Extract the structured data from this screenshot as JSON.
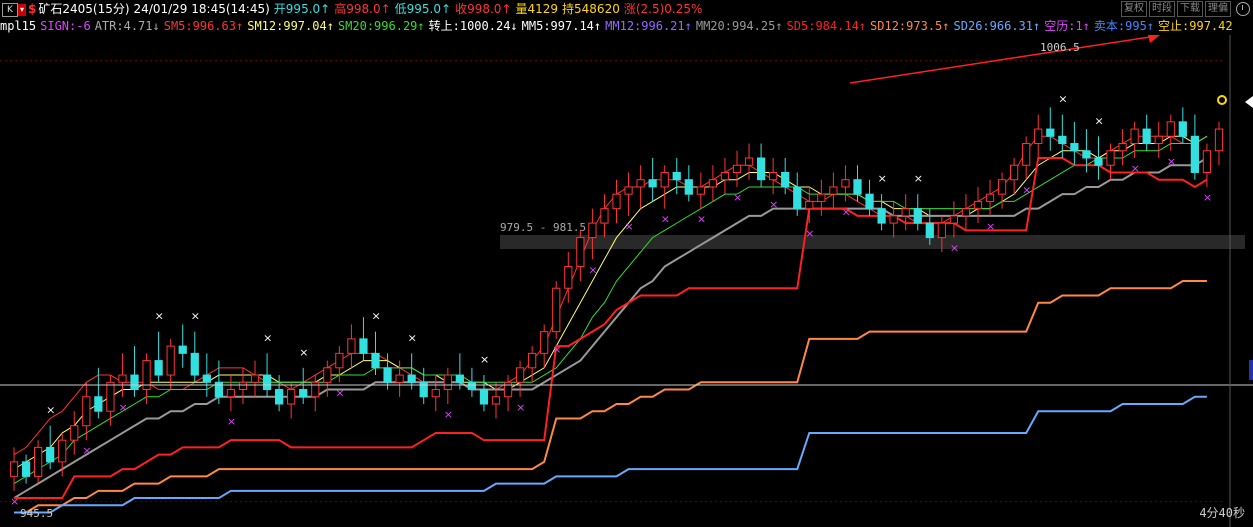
{
  "header": {
    "icon_k": "K",
    "symbol": "矿石2405(15分)",
    "datetime": "24/01/29 18:45(14:45)",
    "open": "开995.0↑",
    "high": "高998.0↑",
    "low": "低995.0↑",
    "close": "收998.0↑",
    "volume": "量4129",
    "hold": "持548620",
    "change": "涨(2.5)0.25%",
    "buttons": [
      "复权",
      "时段",
      "下载",
      "理偏"
    ]
  },
  "indicator": {
    "name": "mpl15",
    "sign": "SIGN:-6",
    "atr": "ATR:4.71↓",
    "sm5": "SM5:996.63↑",
    "sm12": "SM12:997.04↑",
    "sm20": "SM20:996.29↑",
    "turn": "转上:1000.24↓",
    "mm5": "MM5:997.14↑",
    "mm12": "MM12:996.21↑",
    "mm20": "MM20:994.25↑",
    "sd5": "SD5:984.14↑",
    "sd12": "SD12:973.5↑",
    "sd26": "SD26:966.31↑",
    "kongli": "空历:1↑",
    "maiben": "卖本:995↑",
    "kongzhi": "空止:997.42"
  },
  "colors": {
    "up": "#ff3333",
    "down": "#33e0e0",
    "yellow": "#ffd700",
    "sm5": "#ff3333",
    "sm12": "#ffff66",
    "sm20": "#33dd33",
    "mm5": "#ffffff",
    "mm12": "#9966ff",
    "mm20": "#999999",
    "sd5": "#ff2020",
    "sd12": "#ff8844",
    "sd26": "#66aaff",
    "kongli": "#dd44ff",
    "maiben": "#4488ff"
  },
  "annotations": {
    "high_label": "1006.5",
    "low_label": "945.5",
    "range_label": "979.5 - 981.5",
    "countdown": "4分40秒"
  },
  "chart_data": {
    "type": "candlestick",
    "ylim": [
      942,
      1010
    ],
    "ohlc": [
      [
        949,
        953,
        947,
        951
      ],
      [
        951,
        952,
        948,
        949
      ],
      [
        949,
        954,
        948,
        953
      ],
      [
        953,
        956,
        950,
        951
      ],
      [
        951,
        955,
        949,
        954
      ],
      [
        954,
        958,
        952,
        956
      ],
      [
        956,
        962,
        954,
        960
      ],
      [
        960,
        964,
        957,
        958
      ],
      [
        958,
        963,
        956,
        962
      ],
      [
        962,
        966,
        960,
        963
      ],
      [
        963,
        967,
        960,
        961
      ],
      [
        961,
        966,
        959,
        965
      ],
      [
        965,
        969,
        962,
        963
      ],
      [
        963,
        968,
        961,
        967
      ],
      [
        967,
        970,
        964,
        966
      ],
      [
        966,
        969,
        962,
        963
      ],
      [
        963,
        966,
        960,
        962
      ],
      [
        962,
        965,
        959,
        960
      ],
      [
        960,
        963,
        958,
        961
      ],
      [
        961,
        964,
        959,
        962
      ],
      [
        962,
        965,
        960,
        963
      ],
      [
        963,
        966,
        960,
        961
      ],
      [
        961,
        963,
        958,
        959
      ],
      [
        959,
        962,
        957,
        961
      ],
      [
        961,
        964,
        959,
        960
      ],
      [
        960,
        963,
        958,
        962
      ],
      [
        962,
        965,
        960,
        964
      ],
      [
        964,
        967,
        962,
        966
      ],
      [
        966,
        970,
        964,
        968
      ],
      [
        968,
        971,
        965,
        966
      ],
      [
        966,
        969,
        963,
        964
      ],
      [
        964,
        966,
        961,
        962
      ],
      [
        962,
        965,
        960,
        963
      ],
      [
        963,
        966,
        961,
        962
      ],
      [
        962,
        964,
        959,
        960
      ],
      [
        960,
        963,
        958,
        961
      ],
      [
        961,
        964,
        959,
        963
      ],
      [
        963,
        966,
        961,
        962
      ],
      [
        962,
        964,
        960,
        961
      ],
      [
        961,
        963,
        958,
        959
      ],
      [
        959,
        962,
        957,
        960
      ],
      [
        960,
        963,
        958,
        962
      ],
      [
        962,
        965,
        960,
        964
      ],
      [
        964,
        967,
        962,
        966
      ],
      [
        966,
        970,
        964,
        969
      ],
      [
        969,
        976,
        968,
        975
      ],
      [
        975,
        980,
        973,
        978
      ],
      [
        978,
        983,
        976,
        982
      ],
      [
        982,
        986,
        979,
        984
      ],
      [
        984,
        988,
        982,
        986
      ],
      [
        986,
        990,
        984,
        988
      ],
      [
        988,
        991,
        985,
        989
      ],
      [
        989,
        992,
        986,
        990
      ],
      [
        990,
        993,
        987,
        989
      ],
      [
        989,
        992,
        986,
        991
      ],
      [
        991,
        993,
        988,
        990
      ],
      [
        990,
        992,
        987,
        988
      ],
      [
        988,
        991,
        986,
        989
      ],
      [
        989,
        992,
        987,
        990
      ],
      [
        990,
        993,
        988,
        991
      ],
      [
        991,
        994,
        989,
        992
      ],
      [
        992,
        995,
        990,
        993
      ],
      [
        993,
        995,
        989,
        990
      ],
      [
        990,
        993,
        988,
        991
      ],
      [
        991,
        993,
        988,
        989
      ],
      [
        989,
        991,
        985,
        986
      ],
      [
        986,
        989,
        984,
        987
      ],
      [
        987,
        990,
        985,
        988
      ],
      [
        988,
        991,
        986,
        989
      ],
      [
        989,
        992,
        987,
        990
      ],
      [
        990,
        992,
        987,
        988
      ],
      [
        988,
        990,
        985,
        986
      ],
      [
        986,
        988,
        983,
        984
      ],
      [
        984,
        987,
        982,
        985
      ],
      [
        985,
        988,
        983,
        986
      ],
      [
        986,
        988,
        983,
        984
      ],
      [
        984,
        986,
        981,
        982
      ],
      [
        982,
        985,
        980,
        984
      ],
      [
        984,
        987,
        982,
        985
      ],
      [
        985,
        988,
        983,
        986
      ],
      [
        986,
        989,
        984,
        987
      ],
      [
        987,
        990,
        985,
        988
      ],
      [
        988,
        991,
        986,
        990
      ],
      [
        990,
        993,
        988,
        992
      ],
      [
        992,
        996,
        990,
        995
      ],
      [
        995,
        999,
        993,
        997
      ],
      [
        997,
        1000,
        994,
        996
      ],
      [
        996,
        999,
        993,
        995
      ],
      [
        995,
        998,
        992,
        994
      ],
      [
        994,
        997,
        991,
        993
      ],
      [
        993,
        996,
        990,
        992
      ],
      [
        992,
        995,
        990,
        994
      ],
      [
        994,
        997,
        992,
        995
      ],
      [
        995,
        998,
        993,
        997
      ],
      [
        997,
        999,
        994,
        995
      ],
      [
        995,
        998,
        993,
        996
      ],
      [
        996,
        999,
        994,
        998
      ],
      [
        998,
        1000,
        995,
        996
      ],
      [
        996,
        999,
        990,
        991
      ],
      [
        991,
        995,
        989,
        994
      ],
      [
        994,
        998,
        992,
        997
      ]
    ],
    "series": [
      {
        "name": "SM5",
        "values": [
          952,
          953,
          955,
          957,
          958,
          960,
          962,
          963,
          963,
          962,
          962,
          962,
          961,
          961,
          961,
          962,
          963,
          964,
          964,
          964,
          963,
          962,
          962,
          961,
          962,
          963,
          964,
          965,
          966,
          966,
          966,
          965,
          964,
          963,
          962,
          962,
          962,
          962,
          961,
          961,
          961,
          962,
          963,
          965,
          967,
          971,
          975,
          979,
          983,
          986,
          988,
          989,
          989,
          990,
          990,
          990,
          989,
          989,
          990,
          991,
          992,
          992,
          991,
          990,
          989,
          988,
          987,
          987,
          988,
          988,
          987,
          986,
          985,
          985,
          985,
          984,
          984,
          984,
          985,
          986,
          987,
          988,
          989,
          991,
          994,
          996,
          996,
          995,
          994,
          993,
          993,
          994,
          995,
          996,
          996,
          996,
          996,
          995,
          995,
          996
        ]
      },
      {
        "name": "SM12",
        "values": [
          950,
          951,
          952,
          953,
          955,
          956,
          958,
          959,
          960,
          961,
          961,
          962,
          962,
          962,
          962,
          962,
          962,
          963,
          963,
          963,
          963,
          963,
          962,
          962,
          962,
          962,
          963,
          963,
          964,
          965,
          965,
          965,
          964,
          964,
          963,
          963,
          962,
          962,
          962,
          962,
          961,
          961,
          962,
          963,
          964,
          967,
          970,
          973,
          976,
          979,
          982,
          984,
          986,
          987,
          988,
          989,
          989,
          989,
          989,
          990,
          990,
          991,
          991,
          991,
          990,
          989,
          989,
          988,
          988,
          988,
          988,
          987,
          987,
          986,
          986,
          986,
          985,
          985,
          985,
          985,
          986,
          986,
          987,
          988,
          990,
          992,
          993,
          994,
          994,
          994,
          993,
          994,
          994,
          995,
          995,
          995,
          996,
          996,
          995,
          996
        ]
      },
      {
        "name": "SM20",
        "values": [
          948,
          949,
          950,
          951,
          952,
          954,
          955,
          956,
          957,
          958,
          959,
          960,
          960,
          961,
          961,
          961,
          961,
          962,
          962,
          962,
          962,
          962,
          962,
          962,
          962,
          962,
          962,
          963,
          963,
          963,
          964,
          964,
          964,
          964,
          963,
          963,
          963,
          963,
          962,
          962,
          962,
          962,
          962,
          962,
          963,
          964,
          966,
          968,
          971,
          973,
          976,
          978,
          980,
          982,
          983,
          984,
          985,
          986,
          987,
          988,
          988,
          989,
          989,
          989,
          989,
          989,
          988,
          988,
          988,
          988,
          988,
          987,
          987,
          987,
          986,
          986,
          986,
          986,
          986,
          986,
          986,
          986,
          987,
          987,
          988,
          989,
          990,
          991,
          992,
          992,
          993,
          993,
          993,
          994,
          994,
          994,
          995,
          995,
          995,
          996
        ]
      },
      {
        "name": "MM20",
        "values": [
          946,
          947,
          948,
          949,
          950,
          951,
          952,
          953,
          954,
          955,
          956,
          957,
          957,
          958,
          958,
          959,
          959,
          960,
          960,
          960,
          960,
          960,
          960,
          960,
          960,
          960,
          961,
          961,
          961,
          961,
          962,
          962,
          962,
          962,
          962,
          962,
          962,
          962,
          961,
          961,
          961,
          961,
          961,
          961,
          962,
          963,
          964,
          965,
          967,
          969,
          971,
          973,
          975,
          976,
          978,
          979,
          980,
          981,
          982,
          983,
          984,
          985,
          985,
          986,
          986,
          986,
          986,
          986,
          986,
          986,
          986,
          986,
          986,
          985,
          985,
          985,
          985,
          985,
          985,
          985,
          985,
          985,
          985,
          985,
          986,
          986,
          987,
          988,
          988,
          989,
          989,
          990,
          990,
          991,
          991,
          991,
          992,
          992,
          992,
          993
        ]
      },
      {
        "name": "SD5",
        "values": [
          946,
          946,
          946,
          946,
          946,
          949,
          949,
          949,
          949,
          950,
          950,
          951,
          952,
          952,
          953,
          953,
          953,
          953,
          954,
          954,
          954,
          954,
          954,
          953,
          953,
          953,
          953,
          953,
          953,
          953,
          953,
          953,
          953,
          953,
          954,
          955,
          955,
          955,
          955,
          954,
          954,
          954,
          954,
          954,
          954,
          967,
          967,
          968,
          969,
          970,
          972,
          973,
          974,
          974,
          974,
          974,
          975,
          975,
          975,
          975,
          975,
          975,
          975,
          975,
          975,
          975,
          986,
          986,
          986,
          986,
          985,
          985,
          985,
          985,
          984,
          984,
          984,
          984,
          984,
          983,
          983,
          983,
          983,
          983,
          983,
          993,
          993,
          993,
          992,
          992,
          992,
          991,
          991,
          991,
          991,
          990,
          990,
          990,
          989,
          990
        ]
      },
      {
        "name": "SD12",
        "values": [
          944,
          944,
          945,
          945,
          945,
          946,
          946,
          947,
          947,
          947,
          948,
          948,
          948,
          949,
          949,
          949,
          949,
          950,
          950,
          950,
          950,
          950,
          950,
          950,
          950,
          950,
          950,
          950,
          950,
          950,
          950,
          950,
          950,
          950,
          950,
          950,
          950,
          950,
          950,
          950,
          950,
          950,
          950,
          950,
          951,
          957,
          957,
          957,
          958,
          958,
          959,
          959,
          960,
          960,
          961,
          961,
          961,
          962,
          962,
          962,
          962,
          962,
          962,
          962,
          962,
          962,
          968,
          968,
          968,
          968,
          968,
          969,
          969,
          969,
          969,
          969,
          969,
          969,
          969,
          969,
          969,
          969,
          969,
          969,
          969,
          973,
          973,
          974,
          974,
          974,
          974,
          975,
          975,
          975,
          975,
          975,
          975,
          976,
          976,
          976
        ]
      },
      {
        "name": "SD26",
        "values": [
          944,
          944,
          944,
          944,
          945,
          945,
          945,
          945,
          945,
          945,
          946,
          946,
          946,
          946,
          946,
          946,
          946,
          946,
          947,
          947,
          947,
          947,
          947,
          947,
          947,
          947,
          947,
          947,
          947,
          947,
          947,
          947,
          947,
          947,
          947,
          947,
          947,
          947,
          947,
          947,
          948,
          948,
          948,
          948,
          948,
          949,
          949,
          949,
          949,
          949,
          949,
          950,
          950,
          950,
          950,
          950,
          950,
          950,
          950,
          950,
          950,
          950,
          950,
          950,
          950,
          950,
          955,
          955,
          955,
          955,
          955,
          955,
          955,
          955,
          955,
          955,
          955,
          955,
          955,
          955,
          955,
          955,
          955,
          955,
          955,
          958,
          958,
          958,
          958,
          958,
          958,
          958,
          959,
          959,
          959,
          959,
          959,
          959,
          960,
          960
        ]
      }
    ]
  }
}
